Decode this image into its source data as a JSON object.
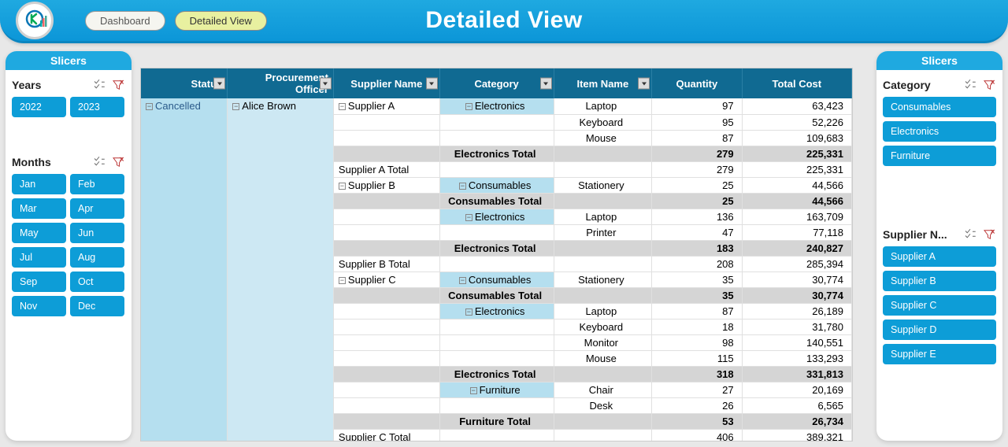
{
  "header": {
    "title": "Detailed View",
    "nav": {
      "dashboard": "Dashboard",
      "detailed": "Detailed View"
    }
  },
  "slicers": {
    "panel_title": "Slicers",
    "years": {
      "label": "Years",
      "items": [
        "2022",
        "2023"
      ]
    },
    "months": {
      "label": "Months",
      "items": [
        "Jan",
        "Feb",
        "Mar",
        "Apr",
        "May",
        "Jun",
        "Jul",
        "Aug",
        "Sep",
        "Oct",
        "Nov",
        "Dec"
      ]
    },
    "category": {
      "label": "Category",
      "items": [
        "Consumables",
        "Electronics",
        "Furniture"
      ]
    },
    "supplier": {
      "label": "Supplier N...",
      "items": [
        "Supplier A",
        "Supplier B",
        "Supplier C",
        "Supplier D",
        "Supplier E"
      ]
    }
  },
  "pivot": {
    "headers": {
      "status": "Status",
      "officer": "Procurement Officer",
      "supplier": "Supplier Name",
      "category": "Category",
      "item": "Item Name",
      "qty": "Quantity",
      "cost": "Total Cost"
    },
    "status": "Cancelled",
    "officer": "Alice Brown",
    "rows": [
      {
        "type": "data",
        "supplier": "Supplier A",
        "category": "Electronics",
        "item": "Laptop",
        "qty": "97",
        "cost": "63,423"
      },
      {
        "type": "data",
        "item": "Keyboard",
        "qty": "95",
        "cost": "52,226"
      },
      {
        "type": "data",
        "item": "Mouse",
        "qty": "87",
        "cost": "109,683"
      },
      {
        "type": "total",
        "label": "Electronics Total",
        "qty": "279",
        "cost": "225,331"
      },
      {
        "type": "suptotal",
        "label": "Supplier A Total",
        "qty": "279",
        "cost": "225,331"
      },
      {
        "type": "data",
        "supplier": "Supplier B",
        "category": "Consumables",
        "item": "Stationery",
        "qty": "25",
        "cost": "44,566"
      },
      {
        "type": "total",
        "label": "Consumables Total",
        "qty": "25",
        "cost": "44,566"
      },
      {
        "type": "data",
        "category": "Electronics",
        "item": "Laptop",
        "qty": "136",
        "cost": "163,709"
      },
      {
        "type": "data",
        "item": "Printer",
        "qty": "47",
        "cost": "77,118"
      },
      {
        "type": "total",
        "label": "Electronics Total",
        "qty": "183",
        "cost": "240,827"
      },
      {
        "type": "suptotal",
        "label": "Supplier B Total",
        "qty": "208",
        "cost": "285,394"
      },
      {
        "type": "data",
        "supplier": "Supplier C",
        "category": "Consumables",
        "item": "Stationery",
        "qty": "35",
        "cost": "30,774"
      },
      {
        "type": "total",
        "label": "Consumables Total",
        "qty": "35",
        "cost": "30,774"
      },
      {
        "type": "data",
        "category": "Electronics",
        "item": "Laptop",
        "qty": "87",
        "cost": "26,189"
      },
      {
        "type": "data",
        "item": "Keyboard",
        "qty": "18",
        "cost": "31,780"
      },
      {
        "type": "data",
        "item": "Monitor",
        "qty": "98",
        "cost": "140,551"
      },
      {
        "type": "data",
        "item": "Mouse",
        "qty": "115",
        "cost": "133,293"
      },
      {
        "type": "total",
        "label": "Electronics Total",
        "qty": "318",
        "cost": "331,813"
      },
      {
        "type": "data",
        "category": "Furniture",
        "item": "Chair",
        "qty": "27",
        "cost": "20,169"
      },
      {
        "type": "data",
        "item": "Desk",
        "qty": "26",
        "cost": "6,565"
      },
      {
        "type": "total",
        "label": "Furniture Total",
        "qty": "53",
        "cost": "26,734"
      },
      {
        "type": "suptotal",
        "label": "Supplier C Total",
        "qty": "406",
        "cost": "389,321"
      }
    ]
  }
}
